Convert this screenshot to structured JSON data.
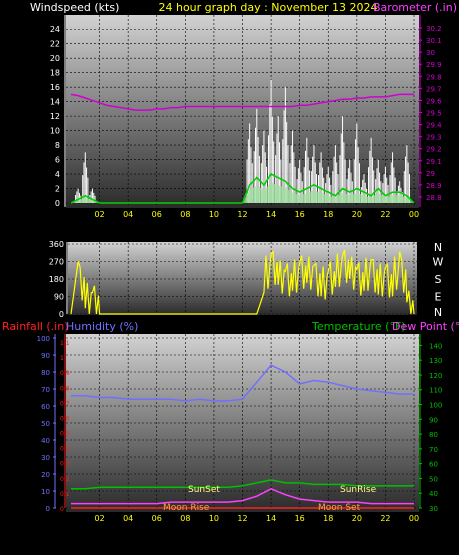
{
  "colors": {
    "background": "#000000",
    "wind": "#ffffff",
    "gust": "#ffffff",
    "wind_avg": "#00d000",
    "wind_fill": "#a0e0a0",
    "baro": "#d000d0",
    "dir": "#ffff00",
    "humidity": "#7070ff",
    "temperature": "#00c000",
    "dew_point": "#ff40ff",
    "rain": "#ff2020",
    "title": "#ffff00",
    "moon": "#ffa040",
    "sun": "#ffff80",
    "axis_labels_time": "#ffff00"
  },
  "header": {
    "windspeed_label": "Windspeed (kts)",
    "title": "24 hour graph day : November 13 2024",
    "barometer_label": "Barometer (.in)"
  },
  "labels": {
    "rainfall": "Rainfall (.in)",
    "humidity": "Humidity (%)",
    "temperature": "Temperature (°F)",
    "dew_point": "Dew Point (°F)",
    "sunset": "SunSet",
    "sunrise": "SunRise",
    "moonrise": "Moon Rise",
    "moonset": "Moon Set"
  },
  "chart_data": [
    {
      "type": "line",
      "name": "wind",
      "xlabel": "Windspeed (kts)",
      "ylabel": "Barometer (.in)",
      "x_ticks": [
        "02",
        "04",
        "06",
        "08",
        "10",
        "12",
        "14",
        "16",
        "18",
        "20",
        "22",
        "00"
      ],
      "wind_y_ticks": [
        "0",
        "2",
        "4",
        "6",
        "8",
        "10",
        "12",
        "14",
        "16",
        "18",
        "20",
        "22",
        "24"
      ],
      "wind_ylim": [
        0,
        25
      ],
      "baro_y_ticks": [
        "28.8",
        "28.9",
        "29",
        "29.1",
        "29.2",
        "29.3",
        "29.4",
        "29.5",
        "29.6",
        "29.7",
        "29.8",
        "29.9",
        "30",
        "30.1",
        "30.2"
      ],
      "baro_ylim": [
        28.75,
        30.25
      ],
      "hours": [
        0,
        0.5,
        1,
        1.5,
        2,
        2.5,
        3,
        3.5,
        4,
        4.5,
        5,
        5.5,
        6,
        6.5,
        7,
        7.5,
        8,
        8.5,
        9,
        9.5,
        10,
        10.5,
        11,
        11.5,
        12,
        12.5,
        13,
        13.5,
        14,
        14.5,
        15,
        15.5,
        16,
        16.5,
        17,
        17.5,
        18,
        18.5,
        19,
        19.5,
        20,
        20.5,
        21,
        21.5,
        22,
        22.5,
        23,
        23.5,
        24
      ],
      "gust_kts": [
        0,
        2,
        7,
        2,
        0,
        0,
        0,
        0,
        0,
        0,
        0,
        0,
        0,
        0,
        0,
        0,
        0,
        0,
        0,
        0,
        0,
        0,
        0,
        0,
        0,
        11,
        13,
        10,
        17,
        12,
        16,
        10,
        6,
        9,
        8,
        7,
        5,
        8,
        12,
        6,
        11,
        4,
        9,
        6,
        5,
        7,
        3,
        8,
        0
      ],
      "wind_avg_kts": [
        0,
        0.5,
        1,
        0.5,
        0,
        0,
        0,
        0,
        0,
        0,
        0,
        0,
        0,
        0,
        0,
        0,
        0,
        0,
        0,
        0,
        0,
        0,
        0,
        0,
        0,
        2.5,
        3.5,
        2.5,
        4,
        3.5,
        3,
        2,
        1.5,
        2,
        2.5,
        2,
        1.5,
        1,
        2,
        1.5,
        2,
        1.5,
        1,
        2,
        1,
        1.5,
        1.5,
        1,
        0
      ],
      "baro_in": [
        29.65,
        29.64,
        29.62,
        29.6,
        29.58,
        29.56,
        29.55,
        29.54,
        29.53,
        29.52,
        29.52,
        29.52,
        29.53,
        29.53,
        29.54,
        29.54,
        29.55,
        29.55,
        29.55,
        29.55,
        29.55,
        29.55,
        29.55,
        29.55,
        29.55,
        29.55,
        29.55,
        29.55,
        29.55,
        29.55,
        29.55,
        29.55,
        29.56,
        29.56,
        29.57,
        29.58,
        29.59,
        29.6,
        29.61,
        29.61,
        29.62,
        29.62,
        29.63,
        29.63,
        29.63,
        29.64,
        29.65,
        29.65,
        29.65
      ]
    },
    {
      "type": "line",
      "name": "wind direction",
      "y_ticks": [
        "360",
        "270",
        "180",
        "90",
        "0"
      ],
      "compass": [
        "N",
        "W",
        "S",
        "E",
        "N"
      ],
      "ylim": [
        0,
        360
      ],
      "hours": [
        0,
        0.5,
        1,
        1.5,
        2,
        2.5,
        3,
        3.5,
        4,
        4.5,
        5,
        5.5,
        6,
        6.5,
        7,
        7.5,
        8,
        8.5,
        9,
        9.5,
        10,
        10.5,
        11,
        11.5,
        12,
        12.5,
        13,
        13.5,
        14,
        14.5,
        15,
        15.5,
        16,
        16.5,
        17,
        17.5,
        18,
        18.5,
        19,
        19.5,
        20,
        20.5,
        21,
        21.5,
        22,
        22.5,
        23,
        23.5,
        24
      ],
      "dir_deg": [
        0,
        270,
        30,
        110,
        0,
        0,
        0,
        0,
        0,
        0,
        0,
        0,
        0,
        0,
        0,
        0,
        0,
        0,
        0,
        0,
        0,
        0,
        0,
        0,
        0,
        0,
        0,
        110,
        310,
        150,
        220,
        120,
        260,
        160,
        250,
        90,
        220,
        140,
        300,
        180,
        230,
        120,
        280,
        100,
        240,
        90,
        320,
        60,
        0
      ]
    },
    {
      "type": "line",
      "name": "temperature humidity",
      "humidity_y_ticks": [
        "0",
        "10",
        "20",
        "30",
        "40",
        "50",
        "60",
        "70",
        "80",
        "90",
        "100"
      ],
      "humidity_ylim": [
        0,
        100
      ],
      "rain_y_ticks": [
        "0",
        "0.1",
        "0.2",
        "0.3",
        "0.4",
        "0.5",
        "0.6",
        "0.7",
        "0.8",
        "0.9",
        "1",
        "1.1"
      ],
      "temp_y_ticks": [
        "30",
        "40",
        "50",
        "60",
        "70",
        "80",
        "90",
        "100",
        "110",
        "120",
        "130",
        "140"
      ],
      "temp_ylim": [
        30,
        145
      ],
      "hours": [
        0,
        1,
        2,
        3,
        4,
        5,
        6,
        7,
        8,
        9,
        10,
        11,
        12,
        13,
        14,
        15,
        16,
        17,
        18,
        19,
        20,
        21,
        22,
        23,
        24
      ],
      "humidity_pct": [
        66,
        66,
        65,
        65,
        64,
        64,
        64,
        64,
        63,
        64,
        63,
        63,
        64,
        74,
        84,
        80,
        73,
        75,
        74,
        72,
        70,
        69,
        68,
        67,
        67
      ],
      "temperature_f": [
        43,
        43,
        44,
        44,
        44,
        44,
        44,
        44,
        44,
        44,
        44,
        44,
        45,
        47,
        49,
        47,
        47,
        46,
        46,
        46,
        45,
        45,
        45,
        45,
        45
      ],
      "dew_point_f": [
        33,
        33,
        33,
        33,
        33,
        33,
        33,
        34,
        34,
        34,
        34,
        34,
        35,
        38,
        43,
        39,
        36,
        35,
        34,
        34,
        34,
        33,
        33,
        33,
        33
      ],
      "rain_in": [
        0,
        0,
        0,
        0,
        0,
        0,
        0,
        0,
        0,
        0,
        0,
        0,
        0,
        0,
        0,
        0,
        0,
        0,
        0,
        0,
        0,
        0,
        0,
        0,
        0
      ]
    }
  ]
}
